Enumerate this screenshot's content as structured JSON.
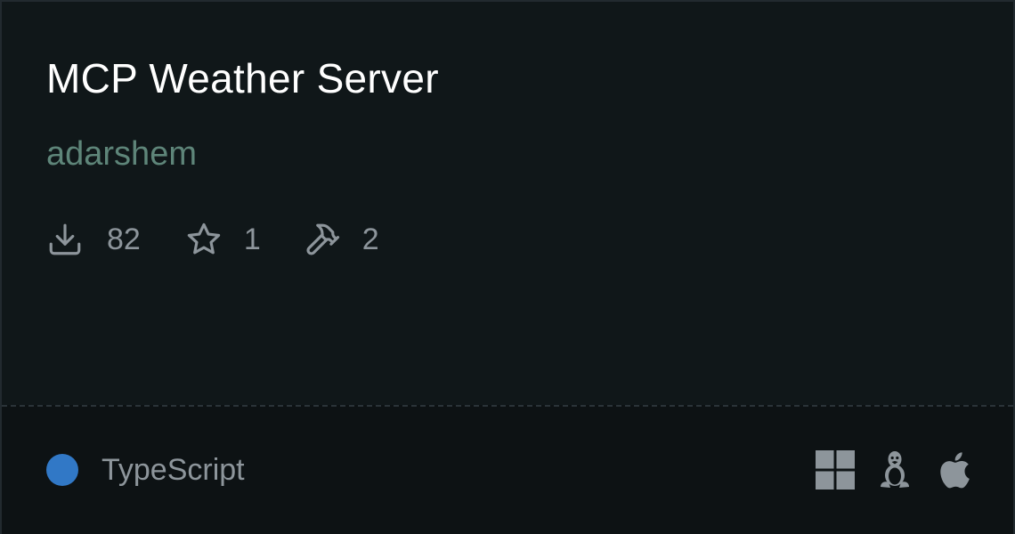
{
  "server": {
    "title": "MCP Weather Server",
    "author": "adarshem"
  },
  "stats": {
    "downloads": "82",
    "stars": "1",
    "tools": "2"
  },
  "footer": {
    "language": "TypeScript",
    "language_color": "#3178c6",
    "platforms": [
      "windows-icon",
      "linux-icon",
      "apple-icon"
    ]
  }
}
